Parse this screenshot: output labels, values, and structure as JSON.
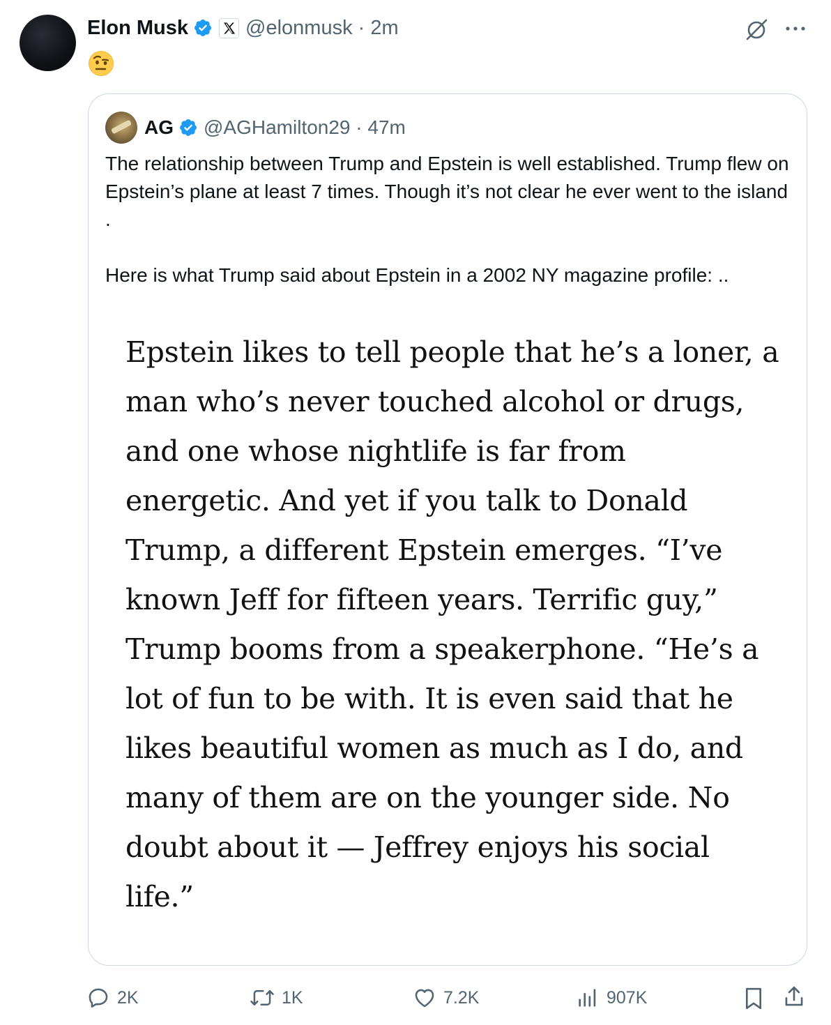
{
  "post": {
    "author_name": "Elon Musk",
    "author_handle": "@elonmusk · 2m",
    "emoji": "🤨"
  },
  "quote": {
    "author_name": "AG",
    "author_handle": "@AGHamilton29 · 47m",
    "paragraph1": "The relationship between Trump and Epstein is well established. Trump flew on Epstein’s plane at least 7 times. Though it’s not clear he ever went to the island .",
    "paragraph2": "Here is what Trump said about Epstein in a 2002 NY magazine profile:  ..",
    "excerpt_lines": [
      "Epstein likes to tell people that he’s a loner, a",
      "man who’s never touched alcohol or drugs,",
      "and one whose nightlife is far from",
      "energetic. And yet if you talk to Donald",
      "Trump, a different Epstein emerges. “I’ve",
      "known Jeff for fifteen years. Terrific guy,”",
      "Trump booms from a speakerphone. “He’s a",
      "lot of fun to be with. It is even said that he",
      "likes beautiful women as much as I do, and",
      "many of them are on the younger side. No",
      "doubt about it — Jeffrey enjoys his social",
      "life.”"
    ]
  },
  "actions": {
    "replies": "2K",
    "reposts": "1K",
    "likes": "7.2K",
    "views": "907K"
  },
  "icons": {
    "verified": "verified-badge-icon",
    "affiliate": "x-logo-icon",
    "grok": "grok-icon",
    "more": "more-icon",
    "reply": "reply-icon",
    "repost": "repost-icon",
    "like": "like-icon",
    "views": "views-icon",
    "bookmark": "bookmark-icon",
    "share": "share-icon"
  },
  "colors": {
    "verified_blue": "#1d9bf0",
    "secondary_text": "#536471",
    "border": "#cfd9de"
  }
}
